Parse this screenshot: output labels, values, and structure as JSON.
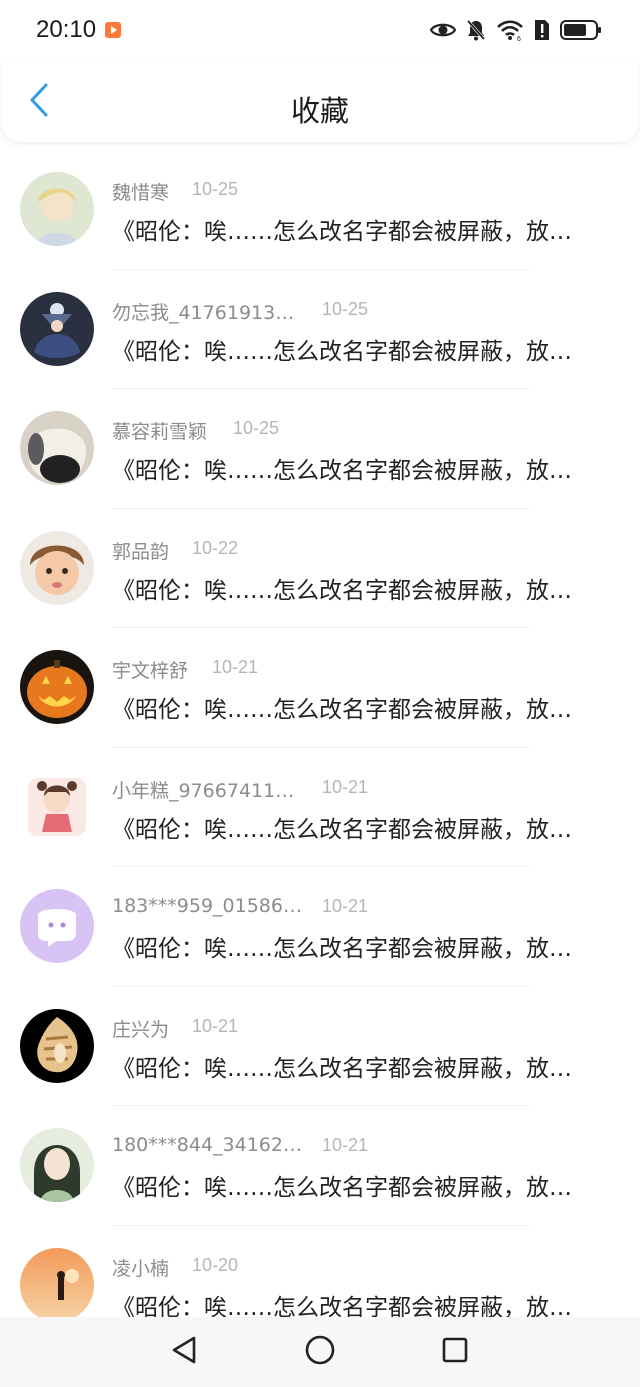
{
  "status_bar": {
    "time": "20:10",
    "icons": [
      "eye-icon",
      "bell-mute-icon",
      "wifi-icon",
      "alert-sim-icon",
      "battery-icon"
    ]
  },
  "header": {
    "back_icon": "chevron-left-icon",
    "title": "收藏"
  },
  "favorites": [
    {
      "name": "魏惜寒",
      "date": "10-25",
      "content": "《昭伦：唉……怎么改名字都会被屏蔽，放…"
    },
    {
      "name": "勿忘我_41761913…",
      "date": "10-25",
      "content": "《昭伦：唉……怎么改名字都会被屏蔽，放…"
    },
    {
      "name": "慕容莉雪颖",
      "date": "10-25",
      "content": "《昭伦：唉……怎么改名字都会被屏蔽，放…"
    },
    {
      "name": "郭品韵",
      "date": "10-22",
      "content": "《昭伦：唉……怎么改名字都会被屏蔽，放…"
    },
    {
      "name": "宇文梓舒",
      "date": "10-21",
      "content": "《昭伦：唉……怎么改名字都会被屏蔽，放…"
    },
    {
      "name": "小年糕_97667411…",
      "date": "10-21",
      "content": "《昭伦：唉……怎么改名字都会被屏蔽，放…"
    },
    {
      "name": "183***959_01586…",
      "date": "10-21",
      "content": "《昭伦：唉……怎么改名字都会被屏蔽，放…"
    },
    {
      "name": "庄兴为",
      "date": "10-21",
      "content": "《昭伦：唉……怎么改名字都会被屏蔽，放…"
    },
    {
      "name": "180***844_34162…",
      "date": "10-21",
      "content": "《昭伦：唉……怎么改名字都会被屏蔽，放…"
    },
    {
      "name": "凌小楠",
      "date": "10-20",
      "content": "《昭伦：唉……怎么改名字都会被屏蔽，放…"
    }
  ],
  "nav_bar": {
    "icons": [
      "back-triangle-icon",
      "home-circle-icon",
      "recents-square-icon"
    ]
  },
  "colors": {
    "accent": "#2f9bea",
    "name_text": "#8c8c8c",
    "date_text": "#b5b5b5"
  }
}
